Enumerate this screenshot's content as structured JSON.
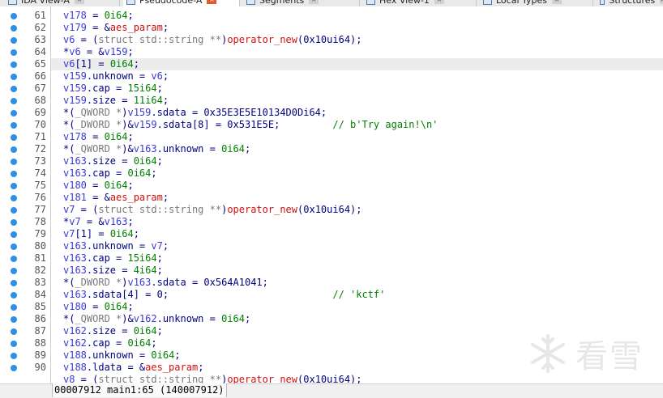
{
  "tabs": [
    {
      "label": "IDA View-A"
    },
    {
      "label": "Pseudocode-A",
      "active": true
    },
    {
      "label": "Segments"
    },
    {
      "label": "Hex View-1"
    },
    {
      "label": "Local Types"
    },
    {
      "label": "Structures"
    }
  ],
  "highlighted_line": "65",
  "lines": [
    {
      "num": "61",
      "tokens": [
        [
          "var",
          "v178"
        ],
        [
          "plain",
          " = "
        ],
        [
          "num",
          "0i64"
        ],
        [
          "plain",
          ";"
        ]
      ]
    },
    {
      "num": "62",
      "tokens": [
        [
          "var",
          "v179"
        ],
        [
          "plain",
          " = &"
        ],
        [
          "red",
          "aes_param"
        ],
        [
          "plain",
          ";"
        ]
      ]
    },
    {
      "num": "63",
      "tokens": [
        [
          "var",
          "v6"
        ],
        [
          "plain",
          " = ("
        ],
        [
          "kw",
          "struct std::string **"
        ],
        [
          "plain",
          ")"
        ],
        [
          "red",
          "operator_new"
        ],
        [
          "plain",
          "(0x10ui64);"
        ]
      ]
    },
    {
      "num": "64",
      "tokens": [
        [
          "plain",
          "*"
        ],
        [
          "var",
          "v6"
        ],
        [
          "plain",
          " = &"
        ],
        [
          "var",
          "v159"
        ],
        [
          "plain",
          ";"
        ]
      ]
    },
    {
      "num": "65",
      "tokens": [
        [
          "var",
          "v6"
        ],
        [
          "plain",
          "[1] = "
        ],
        [
          "num",
          "0i64"
        ],
        [
          "plain",
          ";"
        ]
      ]
    },
    {
      "num": "66",
      "tokens": [
        [
          "var",
          "v159"
        ],
        [
          "plain",
          ".unknown = "
        ],
        [
          "var",
          "v6"
        ],
        [
          "plain",
          ";"
        ]
      ]
    },
    {
      "num": "67",
      "tokens": [
        [
          "var",
          "v159"
        ],
        [
          "plain",
          ".cap = "
        ],
        [
          "num",
          "15i64"
        ],
        [
          "plain",
          ";"
        ]
      ]
    },
    {
      "num": "68",
      "tokens": [
        [
          "var",
          "v159"
        ],
        [
          "plain",
          ".size = "
        ],
        [
          "num",
          "11i64"
        ],
        [
          "plain",
          ";"
        ]
      ]
    },
    {
      "num": "69",
      "tokens": [
        [
          "plain",
          "*("
        ],
        [
          "kw",
          "_QWORD *"
        ],
        [
          "plain",
          ")"
        ],
        [
          "var",
          "v159"
        ],
        [
          "plain",
          ".sdata = 0x35E3E5E10134D0Di64;"
        ]
      ]
    },
    {
      "num": "70",
      "tokens": [
        [
          "plain",
          "*("
        ],
        [
          "kw",
          "_DWORD *"
        ],
        [
          "plain",
          ")&"
        ],
        [
          "var",
          "v159"
        ],
        [
          "plain",
          ".sdata[8] = 0x531E5E;         "
        ],
        [
          "cmt",
          "// b'Try again!\\n'"
        ]
      ]
    },
    {
      "num": "71",
      "tokens": [
        [
          "var",
          "v178"
        ],
        [
          "plain",
          " = "
        ],
        [
          "num",
          "0i64"
        ],
        [
          "plain",
          ";"
        ]
      ]
    },
    {
      "num": "72",
      "tokens": [
        [
          "plain",
          "*("
        ],
        [
          "kw",
          "_QWORD *"
        ],
        [
          "plain",
          ")&"
        ],
        [
          "var",
          "v163"
        ],
        [
          "plain",
          ".unknown = "
        ],
        [
          "num",
          "0i64"
        ],
        [
          "plain",
          ";"
        ]
      ]
    },
    {
      "num": "73",
      "tokens": [
        [
          "var",
          "v163"
        ],
        [
          "plain",
          ".size = "
        ],
        [
          "num",
          "0i64"
        ],
        [
          "plain",
          ";"
        ]
      ]
    },
    {
      "num": "74",
      "tokens": [
        [
          "var",
          "v163"
        ],
        [
          "plain",
          ".cap = "
        ],
        [
          "num",
          "0i64"
        ],
        [
          "plain",
          ";"
        ]
      ]
    },
    {
      "num": "75",
      "tokens": [
        [
          "var",
          "v180"
        ],
        [
          "plain",
          " = "
        ],
        [
          "num",
          "0i64"
        ],
        [
          "plain",
          ";"
        ]
      ]
    },
    {
      "num": "76",
      "tokens": [
        [
          "var",
          "v181"
        ],
        [
          "plain",
          " = &"
        ],
        [
          "red",
          "aes_param"
        ],
        [
          "plain",
          ";"
        ]
      ]
    },
    {
      "num": "77",
      "tokens": [
        [
          "var",
          "v7"
        ],
        [
          "plain",
          " = ("
        ],
        [
          "kw",
          "struct std::string **"
        ],
        [
          "plain",
          ")"
        ],
        [
          "red",
          "operator_new"
        ],
        [
          "plain",
          "(0x10ui64);"
        ]
      ]
    },
    {
      "num": "78",
      "tokens": [
        [
          "plain",
          "*"
        ],
        [
          "var",
          "v7"
        ],
        [
          "plain",
          " = &"
        ],
        [
          "var",
          "v163"
        ],
        [
          "plain",
          ";"
        ]
      ]
    },
    {
      "num": "79",
      "tokens": [
        [
          "var",
          "v7"
        ],
        [
          "plain",
          "[1] = "
        ],
        [
          "num",
          "0i64"
        ],
        [
          "plain",
          ";"
        ]
      ]
    },
    {
      "num": "80",
      "tokens": [
        [
          "var",
          "v163"
        ],
        [
          "plain",
          ".unknown = "
        ],
        [
          "var",
          "v7"
        ],
        [
          "plain",
          ";"
        ]
      ]
    },
    {
      "num": "81",
      "tokens": [
        [
          "var",
          "v163"
        ],
        [
          "plain",
          ".cap = "
        ],
        [
          "num",
          "15i64"
        ],
        [
          "plain",
          ";"
        ]
      ]
    },
    {
      "num": "82",
      "tokens": [
        [
          "var",
          "v163"
        ],
        [
          "plain",
          ".size = "
        ],
        [
          "num",
          "4i64"
        ],
        [
          "plain",
          ";"
        ]
      ]
    },
    {
      "num": "83",
      "tokens": [
        [
          "plain",
          "*("
        ],
        [
          "kw",
          "_DWORD *"
        ],
        [
          "plain",
          ")"
        ],
        [
          "var",
          "v163"
        ],
        [
          "plain",
          ".sdata = 0x564A1041;"
        ]
      ]
    },
    {
      "num": "84",
      "tokens": [
        [
          "var",
          "v163"
        ],
        [
          "plain",
          ".sdata[4] = 0;                            "
        ],
        [
          "cmt",
          "// 'kctf'"
        ]
      ]
    },
    {
      "num": "85",
      "tokens": [
        [
          "var",
          "v180"
        ],
        [
          "plain",
          " = "
        ],
        [
          "num",
          "0i64"
        ],
        [
          "plain",
          ";"
        ]
      ]
    },
    {
      "num": "86",
      "tokens": [
        [
          "plain",
          "*("
        ],
        [
          "kw",
          "_QWORD *"
        ],
        [
          "plain",
          ")&"
        ],
        [
          "var",
          "v162"
        ],
        [
          "plain",
          ".unknown = "
        ],
        [
          "num",
          "0i64"
        ],
        [
          "plain",
          ";"
        ]
      ]
    },
    {
      "num": "87",
      "tokens": [
        [
          "var",
          "v162"
        ],
        [
          "plain",
          ".size = "
        ],
        [
          "num",
          "0i64"
        ],
        [
          "plain",
          ";"
        ]
      ]
    },
    {
      "num": "88",
      "tokens": [
        [
          "var",
          "v162"
        ],
        [
          "plain",
          ".cap = "
        ],
        [
          "num",
          "0i64"
        ],
        [
          "plain",
          ";"
        ]
      ]
    },
    {
      "num": "89",
      "tokens": [
        [
          "var",
          "v188"
        ],
        [
          "plain",
          ".unknown = "
        ],
        [
          "num",
          "0i64"
        ],
        [
          "plain",
          ";"
        ]
      ]
    },
    {
      "num": "90",
      "tokens": [
        [
          "var",
          "v188"
        ],
        [
          "plain",
          ".ldata = &"
        ],
        [
          "red",
          "aes_param"
        ],
        [
          "plain",
          ";"
        ]
      ]
    },
    {
      "num": "",
      "tokens": [
        [
          "var",
          "v8"
        ],
        [
          "plain",
          " = ("
        ],
        [
          "kw",
          "struct std::string **"
        ],
        [
          "plain",
          ")"
        ],
        [
          "red",
          "operator_new"
        ],
        [
          "plain",
          "(0x10ui64);"
        ]
      ]
    }
  ],
  "status": {
    "text": "00007912 main1:65 (140007912)"
  },
  "watermark": {
    "text": "看雪"
  },
  "colors": {
    "breakpoint_dot": "#2f8fe6",
    "active_tab_close": "#e05a2a"
  }
}
